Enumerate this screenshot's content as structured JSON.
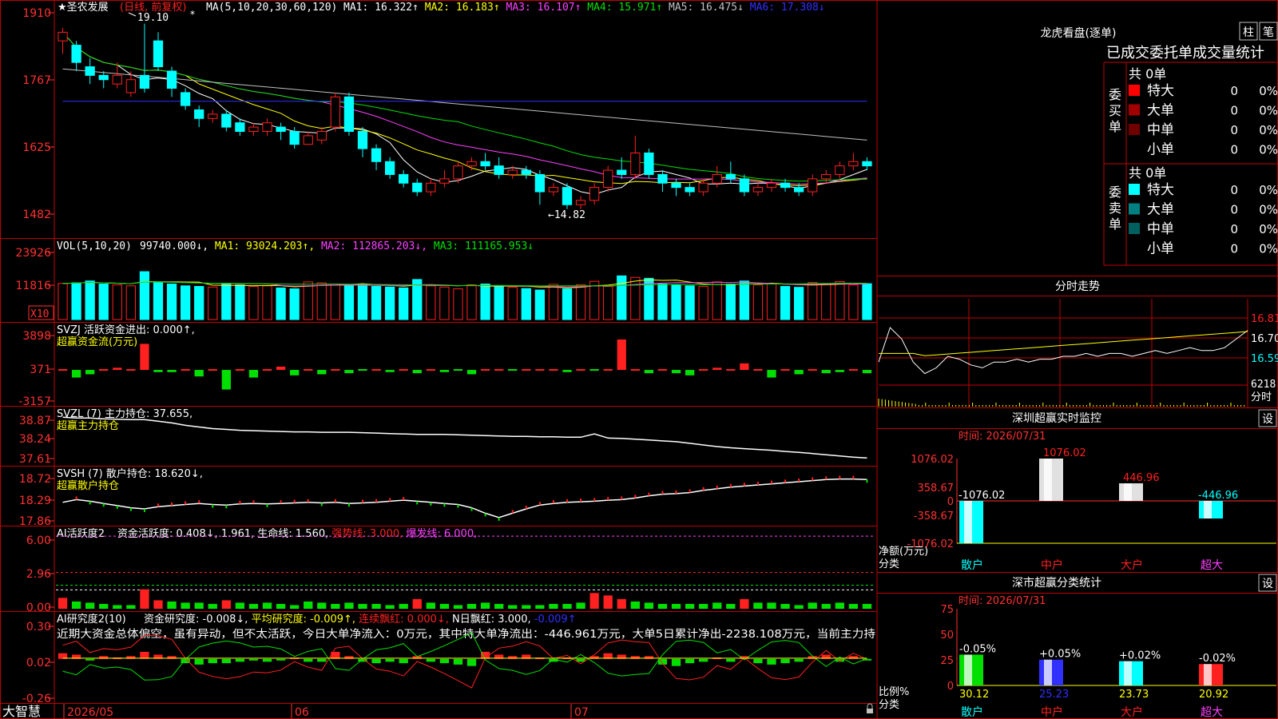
{
  "app": {
    "brand": "大智慧"
  },
  "colors": {
    "up": "#ff2020",
    "down": "#00ffff",
    "frame": "#c00000",
    "axis": "#ff3030",
    "yellow": "#ffff00",
    "white": "#ffffff",
    "magenta": "#ff40ff",
    "green": "#00e000",
    "blue": "#3030ff",
    "gray": "#c0c0c0"
  },
  "main": {
    "stock_name": "★圣农发展",
    "period_tag": "(日线, 前复权)",
    "ma_params": "MA(5,10,20,30,60,120)",
    "ma_readouts": [
      {
        "label": "MA1: 16.322↑",
        "color": "#ffffff"
      },
      {
        "label": "MA2: 16.183↑",
        "color": "#ffff00"
      },
      {
        "label": "MA3: 16.107↑",
        "color": "#ff40ff"
      },
      {
        "label": "MA4: 15.971↑",
        "color": "#00e000"
      },
      {
        "label": "MA5: 16.475↓",
        "color": "#c0c0c0"
      },
      {
        "label": "MA6: 17.308↓",
        "color": "#3030ff"
      }
    ],
    "high_mark": "19.10",
    "low_mark": "←14.82",
    "y_ticks": [
      "1910",
      "1767",
      "1625",
      "1482"
    ]
  },
  "vol": {
    "header": "VOL(5,10,20)",
    "readouts": [
      {
        "label": "99740.000↓,",
        "color": "#ffffff"
      },
      {
        "label": "MA1: 93024.203↑,",
        "color": "#ffff00"
      },
      {
        "label": "MA2: 112865.203↓,",
        "color": "#ff40ff"
      },
      {
        "label": "MA3: 111165.953↓",
        "color": "#00e000"
      }
    ],
    "y_ticks": [
      "23926",
      "11816"
    ],
    "unit_tag": "X10"
  },
  "svzj": {
    "header": "SVZJ  活跃资金进出: 0.000↑,",
    "sub": "超赢资金流(万元)",
    "y_ticks": [
      "3898",
      "371",
      "-3157"
    ]
  },
  "svzl": {
    "header": "SVZL (7) 主力持仓: 37.655,",
    "sub": "超赢主力持仓",
    "y_ticks": [
      "38.87",
      "38.24",
      "37.61"
    ]
  },
  "svsh": {
    "header": "SVSH (7) 散户持仓: 18.620↓,",
    "sub": "超赢散户持仓",
    "y_ticks": [
      "18.72",
      "18.29",
      "17.86"
    ]
  },
  "ai1": {
    "title": "AI活跃度2",
    "readouts": [
      {
        "label": "资金活跃度: 0.408↓,",
        "color": "#ffffff"
      },
      {
        "label": "1.961,",
        "color": "#ffffff"
      },
      {
        "label": "生命线: 1.560,",
        "color": "#ffffff"
      },
      {
        "label": "强势线: 3.000,",
        "color": "#ff2020"
      },
      {
        "label": "爆发线: 6.000,",
        "color": "#ff40ff"
      }
    ],
    "y_ticks": [
      "6.00",
      "2.96",
      "0.00"
    ]
  },
  "ai2": {
    "title": "AI研究度2(10)",
    "readouts": [
      {
        "label": "资金研究度: -0.008↓,",
        "color": "#ffffff"
      },
      {
        "label": "平均研究度: -0.009↑,",
        "color": "#ffff00"
      },
      {
        "label": "连续飘红: 0.000↓,",
        "color": "#ff2020"
      },
      {
        "label": "N日飘红: 3.000,",
        "color": "#ffffff"
      },
      {
        "label": "-0.009↑",
        "color": "#3030ff"
      }
    ],
    "commentary": "近期大资金总体偏空，虽有异动，但不太活跃，今日大单净流入：0万元，其中特大单净流出：-446.961万元，大单5日累计净出-2238.108万元，当前主力持",
    "y_ticks": [
      "0.30",
      "0.02",
      "-0.26"
    ]
  },
  "x_axis": {
    "labels": [
      "2026/05",
      "06",
      "07"
    ]
  },
  "right": {
    "lhkp_title": "龙虎看盘(逐单)",
    "btn_zhu": "柱",
    "btn_bi": "笔",
    "tab_title": "已成交委托单成交量统计",
    "buy": {
      "vertical_label": "委买单",
      "total": "共 0单",
      "rows": [
        {
          "name": "特大",
          "count": "0",
          "pct": "0%",
          "color": "#ff0000"
        },
        {
          "name": "大单",
          "count": "0",
          "pct": "0%",
          "color": "#a00000"
        },
        {
          "name": "中单",
          "count": "0",
          "pct": "0%",
          "color": "#700000"
        },
        {
          "name": "小单",
          "count": "0",
          "pct": "0%",
          "color": "#000000"
        }
      ]
    },
    "sell": {
      "vertical_label": "委卖单",
      "total": "共 0单",
      "rows": [
        {
          "name": "特大",
          "count": "0",
          "pct": "0%",
          "color": "#00ffff"
        },
        {
          "name": "大单",
          "count": "0",
          "pct": "0%",
          "color": "#008080"
        },
        {
          "name": "中单",
          "count": "0",
          "pct": "0%",
          "color": "#006060"
        },
        {
          "name": "小单",
          "count": "0",
          "pct": "0%",
          "color": "#000000"
        }
      ]
    },
    "intraday": {
      "title": "分时走势",
      "price_ticks": [
        "16.81",
        "16.70",
        "16.59"
      ],
      "vol_tick": "6218",
      "vol_unit": "分时"
    },
    "sz_monitor": {
      "title": "深圳超赢实时监控",
      "btn": "设",
      "time": "时间: 2026/07/31",
      "y_ticks": [
        "1076.02",
        "358.67",
        "0",
        "-358.67",
        "-1076.02"
      ],
      "y_label": "净额(万元)",
      "x_label": "分类"
    },
    "sz_class": {
      "title": "深市超赢分类统计",
      "btn": "设",
      "time": "时间: 2026/07/31",
      "y_ticks": [
        "75",
        "50",
        "25",
        "0"
      ],
      "y_label": "比例%",
      "x_label": "分类"
    }
  },
  "chart_data": [
    {
      "type": "candlestick",
      "name": "日K线",
      "ylim": [
        14.2,
        19.5
      ],
      "candles": [
        [
          18.7,
          18.9,
          18.4,
          19.0
        ],
        [
          18.6,
          18.2,
          18.0,
          18.7
        ],
        [
          18.1,
          17.9,
          17.7,
          18.3
        ],
        [
          17.9,
          17.8,
          17.6,
          18.0
        ],
        [
          17.7,
          17.9,
          17.6,
          18.2
        ],
        [
          17.5,
          17.8,
          17.4,
          18.0
        ],
        [
          17.9,
          17.6,
          17.5,
          19.1
        ],
        [
          18.7,
          18.1,
          18.0,
          18.9
        ],
        [
          18.0,
          17.6,
          17.4,
          18.1
        ],
        [
          17.5,
          17.2,
          17.1,
          17.6
        ],
        [
          17.1,
          16.9,
          16.7,
          17.2
        ],
        [
          16.9,
          17.0,
          16.8,
          17.1
        ],
        [
          17.0,
          16.7,
          16.6,
          17.1
        ],
        [
          16.8,
          16.6,
          16.5,
          16.9
        ],
        [
          16.6,
          16.7,
          16.5,
          16.8
        ],
        [
          16.6,
          16.8,
          16.5,
          16.9
        ],
        [
          16.7,
          16.6,
          16.4,
          16.8
        ],
        [
          16.6,
          16.3,
          16.2,
          16.7
        ],
        [
          16.3,
          16.5,
          16.3,
          16.6
        ],
        [
          16.4,
          16.6,
          16.3,
          16.7
        ],
        [
          16.7,
          17.4,
          16.6,
          17.5
        ],
        [
          17.4,
          16.6,
          16.5,
          17.5
        ],
        [
          16.6,
          16.2,
          16.0,
          16.7
        ],
        [
          16.2,
          15.9,
          15.7,
          16.3
        ],
        [
          15.9,
          15.6,
          15.5,
          16.0
        ],
        [
          15.6,
          15.4,
          15.3,
          15.7
        ],
        [
          15.4,
          15.2,
          15.1,
          15.5
        ],
        [
          15.2,
          15.4,
          15.1,
          15.5
        ],
        [
          15.4,
          15.5,
          15.3,
          15.7
        ],
        [
          15.5,
          15.8,
          15.4,
          15.9
        ],
        [
          15.8,
          15.9,
          15.7,
          16.0
        ],
        [
          15.9,
          15.8,
          15.7,
          16.1
        ],
        [
          15.8,
          15.6,
          15.5,
          16.0
        ],
        [
          15.6,
          15.7,
          15.5,
          15.8
        ],
        [
          15.7,
          15.6,
          15.5,
          15.8
        ],
        [
          15.6,
          15.2,
          14.9,
          15.7
        ],
        [
          15.2,
          15.3,
          15.1,
          15.4
        ],
        [
          15.3,
          14.9,
          14.8,
          15.4
        ],
        [
          14.9,
          15.0,
          14.8,
          15.1
        ],
        [
          15.0,
          15.3,
          14.9,
          15.4
        ],
        [
          15.3,
          15.7,
          15.2,
          15.8
        ],
        [
          15.7,
          15.6,
          15.5,
          16.0
        ],
        [
          15.6,
          16.1,
          15.5,
          16.5
        ],
        [
          16.1,
          15.6,
          15.5,
          16.2
        ],
        [
          15.6,
          15.4,
          15.2,
          15.7
        ],
        [
          15.4,
          15.3,
          15.1,
          15.5
        ],
        [
          15.3,
          15.2,
          15.1,
          15.4
        ],
        [
          15.2,
          15.4,
          15.1,
          15.5
        ],
        [
          15.4,
          15.6,
          15.3,
          15.8
        ],
        [
          15.6,
          15.5,
          15.4,
          15.9
        ],
        [
          15.5,
          15.2,
          15.1,
          15.6
        ],
        [
          15.2,
          15.3,
          15.1,
          15.4
        ],
        [
          15.3,
          15.4,
          15.2,
          15.5
        ],
        [
          15.4,
          15.3,
          15.2,
          15.5
        ],
        [
          15.3,
          15.2,
          15.1,
          15.4
        ],
        [
          15.2,
          15.5,
          15.1,
          15.6
        ],
        [
          15.5,
          15.6,
          15.4,
          15.7
        ],
        [
          15.6,
          15.8,
          15.5,
          15.9
        ],
        [
          15.8,
          15.9,
          15.7,
          16.1
        ],
        [
          15.9,
          15.8,
          15.7,
          16.0
        ]
      ]
    },
    {
      "type": "bar",
      "name": "VOL",
      "ylim": [
        0,
        26000
      ],
      "values": [
        12000,
        12200,
        12800,
        11800,
        11500,
        11200,
        15900,
        12300,
        11800,
        11200,
        11000,
        10800,
        12000,
        11500,
        11000,
        11200,
        10500,
        10200,
        12500,
        12200,
        11800,
        11500,
        11600,
        11000,
        10800,
        10500,
        13300,
        11200,
        10800,
        10200,
        11500,
        11800,
        11300,
        10700,
        10300,
        9800,
        11700,
        10200,
        11600,
        12700,
        11000,
        14500,
        14000,
        13700,
        11800,
        11500,
        11200,
        11000,
        12500,
        11800,
        12800,
        11500,
        11900,
        11000,
        10700,
        12300,
        12000,
        12600,
        11500,
        11900
      ]
    },
    {
      "type": "bar",
      "name": "SVZJ 活跃资金进出",
      "ylim": [
        -3157,
        3898
      ],
      "values": [
        0,
        -700,
        -400,
        0,
        200,
        0,
        2400,
        -200,
        -200,
        0,
        -600,
        0,
        -1800,
        0,
        -700,
        0,
        300,
        -500,
        0,
        -400,
        0,
        -300,
        -100,
        0,
        -200,
        0,
        -300,
        0,
        -200,
        -100,
        -400,
        0,
        0,
        -100,
        0,
        0,
        0,
        -200,
        0,
        -100,
        0,
        2800,
        0,
        -300,
        0,
        -300,
        -500,
        0,
        200,
        0,
        600,
        0,
        -700,
        0,
        -400,
        0,
        -300,
        -200,
        0,
        -300
      ]
    },
    {
      "type": "line",
      "name": "SVZL 主力持仓",
      "ylim": [
        37.55,
        38.92
      ],
      "values": [
        38.72,
        38.7,
        38.7,
        38.68,
        38.67,
        38.66,
        38.66,
        38.62,
        38.58,
        38.52,
        38.48,
        38.44,
        38.42,
        38.4,
        38.39,
        38.38,
        38.37,
        38.36,
        38.36,
        38.35,
        38.35,
        38.35,
        38.34,
        38.33,
        38.32,
        38.31,
        38.3,
        38.3,
        38.3,
        38.29,
        38.28,
        38.27,
        38.26,
        38.25,
        38.25,
        38.24,
        38.24,
        38.23,
        38.23,
        38.31,
        38.21,
        38.2,
        38.18,
        38.16,
        38.14,
        38.12,
        38.08,
        38.04,
        38.0,
        37.97,
        37.95,
        37.93,
        37.91,
        37.88,
        37.86,
        37.83,
        37.8,
        37.77,
        37.74,
        37.72
      ]
    },
    {
      "type": "line",
      "name": "SVSH 散户持仓",
      "ylim": [
        17.8,
        18.8
      ],
      "values": [
        18.2,
        18.25,
        18.22,
        18.18,
        18.14,
        18.1,
        18.08,
        18.12,
        18.14,
        18.16,
        18.18,
        18.16,
        18.15,
        18.17,
        18.18,
        18.17,
        18.18,
        18.19,
        18.2,
        18.19,
        18.2,
        18.18,
        18.19,
        18.2,
        18.22,
        18.24,
        18.22,
        18.2,
        18.18,
        18.16,
        18.1,
        18.0,
        17.92,
        18.0,
        18.08,
        18.15,
        18.18,
        18.2,
        18.21,
        18.22,
        18.24,
        18.25,
        18.28,
        18.32,
        18.35,
        18.36,
        18.38,
        18.42,
        18.45,
        18.48,
        18.5,
        18.52,
        18.54,
        18.56,
        18.58,
        18.6,
        18.62,
        18.63,
        18.63,
        18.62
      ]
    },
    {
      "type": "bar",
      "name": "AI活跃度 资金活跃度",
      "ylim": [
        0,
        6.6
      ],
      "values": [
        0.9,
        0.6,
        0.5,
        0.4,
        0.3,
        0.3,
        1.6,
        0.7,
        0.6,
        0.5,
        0.5,
        0.4,
        0.7,
        0.5,
        0.4,
        0.5,
        0.4,
        0.3,
        0.6,
        0.5,
        0.4,
        0.5,
        0.4,
        0.4,
        0.3,
        0.4,
        0.8,
        0.5,
        0.4,
        0.3,
        0.4,
        0.5,
        0.4,
        0.3,
        0.3,
        0.3,
        0.4,
        0.4,
        0.5,
        1.3,
        1.1,
        0.8,
        0.6,
        0.5,
        0.4,
        0.4,
        0.4,
        0.4,
        0.5,
        0.4,
        0.8,
        0.5,
        0.5,
        0.4,
        0.3,
        0.5,
        0.4,
        0.5,
        0.4,
        0.4
      ],
      "reference_lines": [
        {
          "name": "强势线",
          "value": 3.0
        },
        {
          "name": "爆发线",
          "value": 6.0
        },
        {
          "name": "生命线",
          "value": 1.56
        }
      ]
    },
    {
      "type": "bar",
      "name": "AI研究度 资金研究度",
      "ylim": [
        -0.3,
        0.32
      ],
      "values": [
        0.04,
        0.03,
        -0.01,
        0.02,
        0.01,
        0.02,
        0.05,
        0.03,
        0.02,
        -0.03,
        -0.04,
        -0.03,
        -0.03,
        -0.02,
        -0.01,
        -0.02,
        -0.01,
        0.01,
        -0.02,
        -0.02,
        0.05,
        0.02,
        -0.02,
        -0.03,
        -0.02,
        -0.03,
        0.02,
        -0.02,
        -0.03,
        -0.04,
        -0.05,
        0.05,
        0.03,
        0.02,
        0.03,
        0.01,
        -0.02,
        0.01,
        -0.02,
        0.02,
        0.04,
        0.03,
        0.02,
        0.02,
        -0.04,
        -0.05,
        -0.03,
        -0.02,
        0.01,
        -0.02,
        0.02,
        -0.03,
        -0.04,
        -0.03,
        -0.02,
        0.02,
        0.03,
        -0.02,
        0.02,
        -0.01
      ]
    },
    {
      "type": "line",
      "name": "分时走势",
      "ylim": [
        16.54,
        16.84
      ],
      "values": [
        16.62,
        16.74,
        16.7,
        16.62,
        16.58,
        16.6,
        16.64,
        16.63,
        16.61,
        16.6,
        16.62,
        16.62,
        16.63,
        16.62,
        16.63,
        16.63,
        16.64,
        16.64,
        16.65,
        16.64,
        16.65,
        16.65,
        16.64,
        16.65,
        16.66,
        16.65,
        16.66,
        16.67,
        16.66,
        16.66,
        16.67,
        16.7,
        16.73
      ]
    },
    {
      "type": "bar",
      "name": "深圳超赢实时监控",
      "categories": [
        "散户",
        "中户",
        "大户",
        "超大"
      ],
      "values": [
        -1076.02,
        1076.02,
        446.96,
        -446.96
      ],
      "ylim": [
        -1076.02,
        1076.02
      ]
    },
    {
      "type": "bar",
      "name": "深市超赢分类统计",
      "categories": [
        "散户",
        "中户",
        "大户",
        "超大"
      ],
      "values": [
        30.12,
        25.23,
        23.73,
        20.92
      ],
      "changes": [
        "-0.05%",
        "+0.05%",
        "+0.02%",
        "-0.02%"
      ],
      "ylim": [
        0,
        75
      ]
    }
  ]
}
